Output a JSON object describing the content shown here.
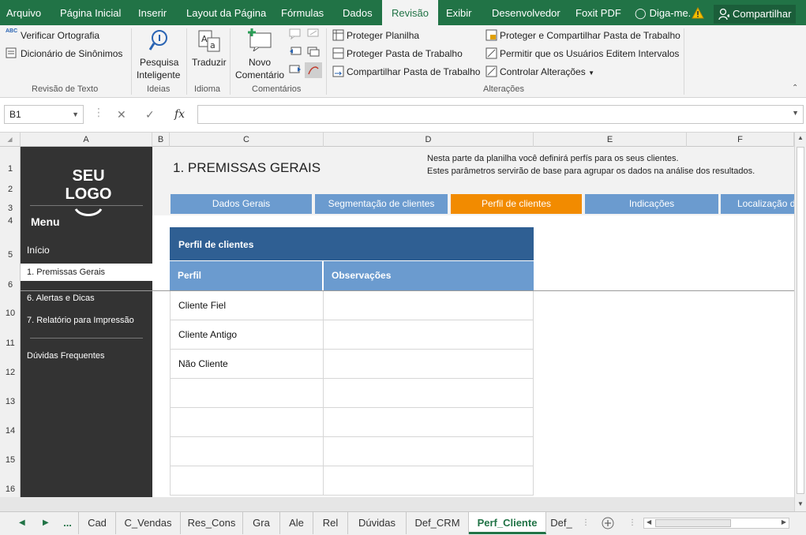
{
  "ribbon_tabs": [
    "Arquivo",
    "Página Inicial",
    "Inserir",
    "Layout da Página",
    "Fórmulas",
    "Dados",
    "Revisão",
    "Exibir",
    "Desenvolvedor",
    "Foxit PDF"
  ],
  "active_tab": "Revisão",
  "tell_me": "Diga-me.",
  "share_label": "Compartilhar",
  "ribbon": {
    "spelling": "Verificar Ortografia",
    "thesaurus": "Dicionário de Sinônimos",
    "group_proofing": "Revisão de Texto",
    "smart_lookup_1": "Pesquisa",
    "smart_lookup_2": "Inteligente",
    "group_insights": "Ideias",
    "translate": "Traduzir",
    "group_language": "Idioma",
    "new_comment_1": "Novo",
    "new_comment_2": "Comentário",
    "group_comments": "Comentários",
    "protect_sheet": "Proteger Planilha",
    "protect_workbook": "Proteger Pasta de Trabalho",
    "share_workbook": "Compartilhar Pasta de Trabalho",
    "protect_share": "Proteger e Compartilhar Pasta de Trabalho",
    "allow_edit": "Permitir que os Usuários Editem Intervalos",
    "track_changes": "Controlar Alterações",
    "group_changes": "Alterações"
  },
  "formula_bar": {
    "name_box": "B1",
    "fx": "fx",
    "value": ""
  },
  "columns": [
    "A",
    "B",
    "C",
    "D",
    "E",
    "F"
  ],
  "rows": [
    "1",
    "2",
    "3",
    "4",
    "5",
    "6",
    "10",
    "11",
    "12",
    "13",
    "14",
    "15",
    "16"
  ],
  "sidebar": {
    "logo": "SEU LOGO",
    "menu_title": "Menu",
    "items": [
      "Início",
      "1. Premissas Gerais",
      "6. Alertas e Dicas",
      "7. Relatório para Impressão",
      "Dúvidas Frequentes"
    ],
    "active_index": 1
  },
  "page": {
    "title": "1. PREMISSAS GERAIS",
    "intro_line1": "Nesta parte da planilha você definirá perfís para os seus  clientes.",
    "intro_line2": "Estes parâmetros servirão de base para agrupar os dados na análise dos resultados."
  },
  "nav_tabs": [
    "Dados Gerais",
    "Segmentação de clientes",
    "Perfil de clientes",
    "Indicações",
    "Localização d"
  ],
  "nav_active": "Perfil de clientes",
  "table": {
    "title": "Perfil de clientes",
    "col_perfil": "Perfil",
    "col_obs": "Observações",
    "rows": [
      {
        "perfil": "Cliente Fiel",
        "obs": ""
      },
      {
        "perfil": "Cliente Antigo",
        "obs": ""
      },
      {
        "perfil": "Não Cliente",
        "obs": ""
      },
      {
        "perfil": "",
        "obs": ""
      },
      {
        "perfil": "",
        "obs": ""
      },
      {
        "perfil": "",
        "obs": ""
      },
      {
        "perfil": "",
        "obs": ""
      }
    ]
  },
  "sheet_tabs": [
    "...",
    "Cad",
    "C_Vendas",
    "Res_Cons",
    "Gra",
    "Ale",
    "Rel",
    "Dúvidas",
    "Def_CRM",
    "Perf_Cliente",
    "Def_"
  ],
  "active_sheet": "Perf_Cliente",
  "colors": {
    "excel_green": "#217346",
    "nav_blue": "#6b9bcf",
    "nav_active": "#f28b00",
    "header_blue": "#2f5f93",
    "sidebar": "#333333"
  }
}
